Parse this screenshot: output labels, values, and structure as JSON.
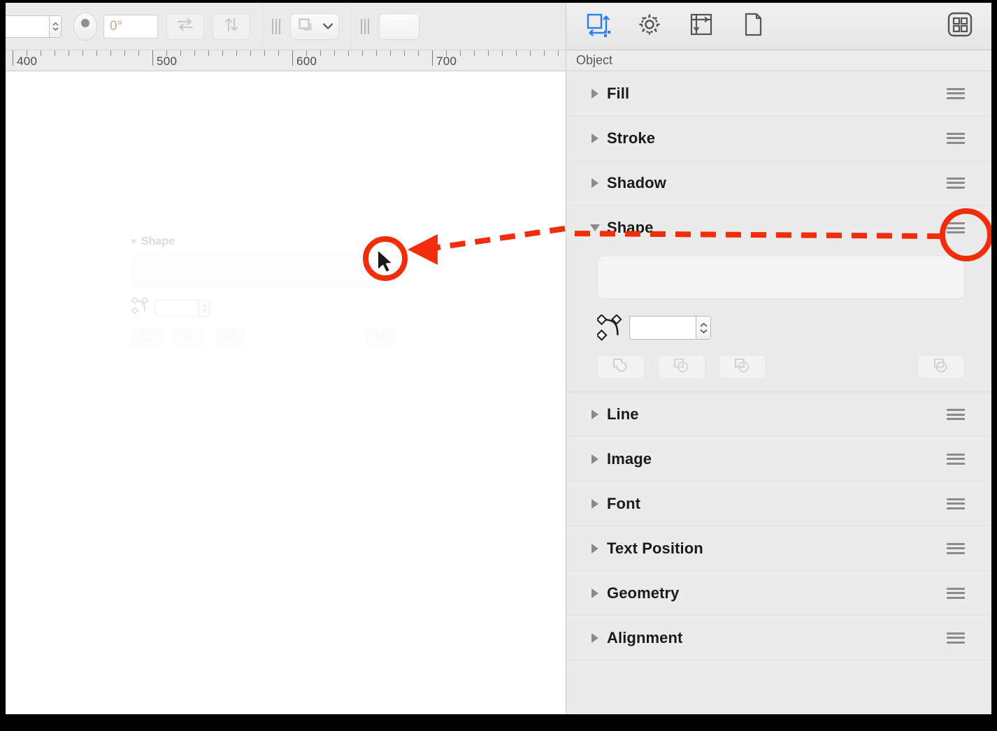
{
  "window": {
    "frame_color": "#000000",
    "canvas_bg": "#ffffff",
    "panel_bg": "#ebebeb"
  },
  "toolbar": {
    "size_field_value": "",
    "size_field_placeholder": "",
    "rotation_knob": "rotation-knob",
    "angle_field_value": "0°",
    "swap_button": "swap-horizontal-icon",
    "flip_button": "flip-vertical-icon",
    "shape_popup": "shape-popup-button",
    "blank_button": "",
    "icons": {
      "swap": "swap-horizontal-icon",
      "flip": "flip-vertical-icon",
      "layers": "layers-icon",
      "chevron": "chevron-down-icon"
    }
  },
  "ruler": {
    "unit_labels": [
      "400",
      "500",
      "600",
      "700"
    ],
    "label_positions": [
      16,
      216,
      416,
      616
    ],
    "major_positions": [
      10,
      210,
      410,
      610
    ],
    "minor_step": 20,
    "orientation": "horizontal"
  },
  "canvas": {
    "ghost": {
      "title": "Shape",
      "disclosure": "expanded",
      "hamburger": "drag-handle-icon"
    },
    "annotation": {
      "color": "#f22d0c",
      "style": "dashed-arrow",
      "cursor": "mouse-pointer",
      "description": "drag from Shape hamburger to canvas"
    }
  },
  "inspector": {
    "tabs": [
      {
        "name": "object-tab",
        "icon": "object-transform-icon",
        "active": true
      },
      {
        "name": "settings-tab",
        "icon": "gear-icon",
        "active": false
      },
      {
        "name": "canvas-tab",
        "icon": "canvas-axes-icon",
        "active": false
      },
      {
        "name": "document-tab",
        "icon": "document-icon",
        "active": false
      }
    ],
    "panels_button": {
      "name": "panels-button",
      "icon": "grid-squares-icon"
    },
    "active_tab_color": "#2a7ff0",
    "title": "Object",
    "sections": [
      {
        "label": "Fill",
        "expanded": false,
        "handle": "drag-handle-icon"
      },
      {
        "label": "Stroke",
        "expanded": false,
        "handle": "drag-handle-icon"
      },
      {
        "label": "Shadow",
        "expanded": false,
        "handle": "drag-handle-icon"
      },
      {
        "label": "Shape",
        "expanded": true,
        "handle": "drag-handle-icon",
        "highlighted": true
      },
      {
        "label": "Line",
        "expanded": false,
        "handle": "drag-handle-icon"
      },
      {
        "label": "Image",
        "expanded": false,
        "handle": "drag-handle-icon"
      },
      {
        "label": "Font",
        "expanded": false,
        "handle": "drag-handle-icon"
      },
      {
        "label": "Text Position",
        "expanded": false,
        "handle": "drag-handle-icon"
      },
      {
        "label": "Geometry",
        "expanded": false,
        "handle": "drag-handle-icon"
      },
      {
        "label": "Alignment",
        "expanded": false,
        "handle": "drag-handle-icon"
      }
    ],
    "shape_panel": {
      "preview_value": "",
      "corner_field_value": "",
      "corner_icon": "bezier-curve-icon",
      "operations": [
        {
          "name": "union-button",
          "icon": "boolean-union-icon",
          "enabled": false
        },
        {
          "name": "intersect-button",
          "icon": "boolean-intersect-icon",
          "enabled": false
        },
        {
          "name": "subtract-button",
          "icon": "boolean-subtract-icon",
          "enabled": false
        },
        {
          "name": "combine-button",
          "icon": "boolean-combine-icon",
          "enabled": false
        }
      ]
    }
  }
}
